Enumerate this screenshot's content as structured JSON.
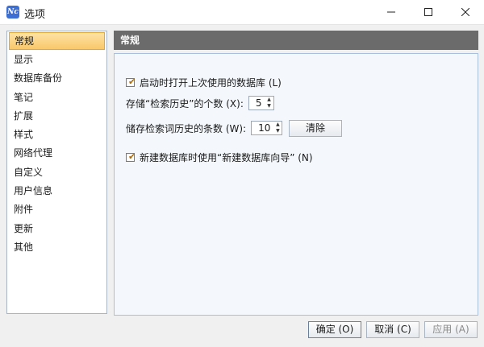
{
  "window": {
    "title": "选项",
    "icon": "app-icon",
    "icon_text": "Nc"
  },
  "nav": {
    "items": [
      {
        "label": "常规"
      },
      {
        "label": "显示"
      },
      {
        "label": "数据库备份"
      },
      {
        "label": "笔记"
      },
      {
        "label": "扩展"
      },
      {
        "label": "样式"
      },
      {
        "label": "网络代理"
      },
      {
        "label": "自定义"
      },
      {
        "label": "用户信息"
      },
      {
        "label": "附件"
      },
      {
        "label": "更新"
      },
      {
        "label": "其他"
      }
    ],
    "active_index": 0
  },
  "section": {
    "title": "常规"
  },
  "settings": {
    "open_last_db": {
      "label": "启动时打开上次使用的数据库 (L)",
      "checked": true
    },
    "search_history_count": {
      "label": "存储“检索历史”的个数 (X):",
      "value": "5"
    },
    "search_term_count": {
      "label": "储存检索词历史的条数 (W):",
      "value": "10",
      "clear_label": "清除"
    },
    "use_db_wizard": {
      "label": "新建数据库时使用“新建数据库向导” (N)",
      "checked": true
    }
  },
  "footer": {
    "ok_label": "确定 (O)",
    "cancel_label": "取消 (C)",
    "apply_label": "应用 (A)"
  },
  "colors": {
    "accent": "#f9c86a",
    "header": "#6b6b6b",
    "panel": "#f4f8fc"
  }
}
